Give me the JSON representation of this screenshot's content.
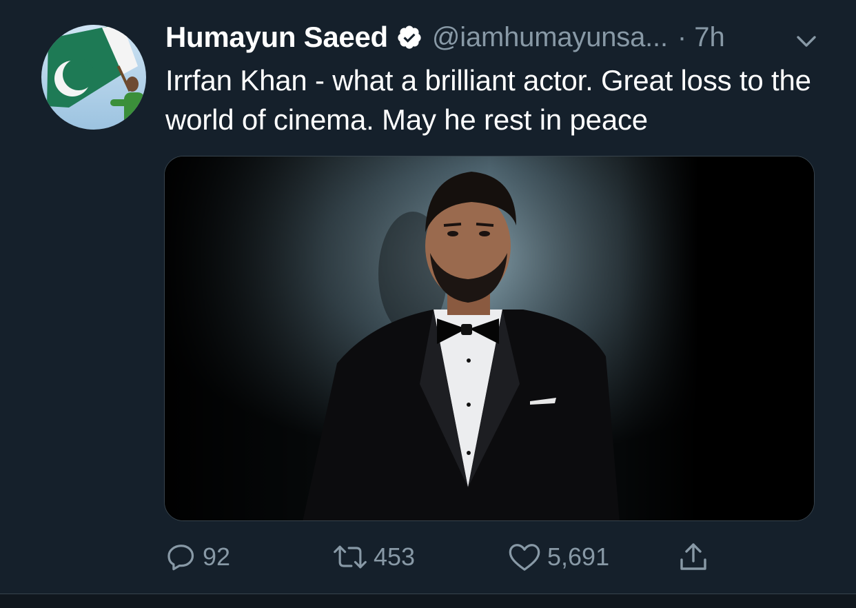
{
  "tweet": {
    "author": {
      "display_name": "Humayun Saeed",
      "handle": "@iamhumayunsa...",
      "verified": true,
      "avatar_icon": "avatar-man-waving-pakistan-flag"
    },
    "timestamp": "· 7h",
    "text": "Irrfan Khan - what a brilliant actor. Great loss to the world of cinema. May he rest in peace",
    "media": {
      "description_icon": "photo-man-in-black-tuxedo-bow-tie"
    },
    "actions": {
      "reply_count": "92",
      "retweet_count": "453",
      "like_count": "5,691"
    }
  },
  "colors": {
    "background": "#15202b",
    "primary_text": "#ffffff",
    "secondary_text": "#8899a6",
    "border": "#38444d"
  }
}
